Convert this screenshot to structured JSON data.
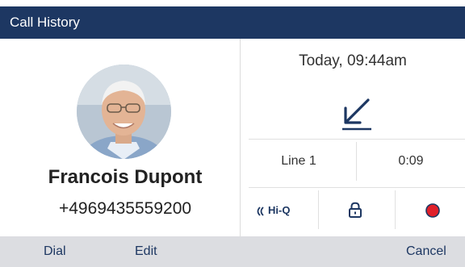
{
  "titlebar": {
    "title": "Call History"
  },
  "contact": {
    "name": "Francois Dupont",
    "number": "+4969435559200",
    "avatar_icon": "contact-photo"
  },
  "call_details": {
    "timestamp": "Today, 09:44am",
    "direction_icon": "incoming-call-arrow-icon",
    "line": "Line 1",
    "duration": "0:09",
    "hiq_label": "Hi-Q",
    "hiq_icon": "hi-q-waves-icon",
    "lock_icon": "lock-icon",
    "record_icon": "record-icon"
  },
  "softkeys": {
    "dial": "Dial",
    "edit": "Edit",
    "cancel": "Cancel"
  },
  "colors": {
    "titlebar_bg": "#1d3762",
    "accent": "#1d3762",
    "softkey_bg": "#dcdde1",
    "record_red": "#e0202a"
  }
}
